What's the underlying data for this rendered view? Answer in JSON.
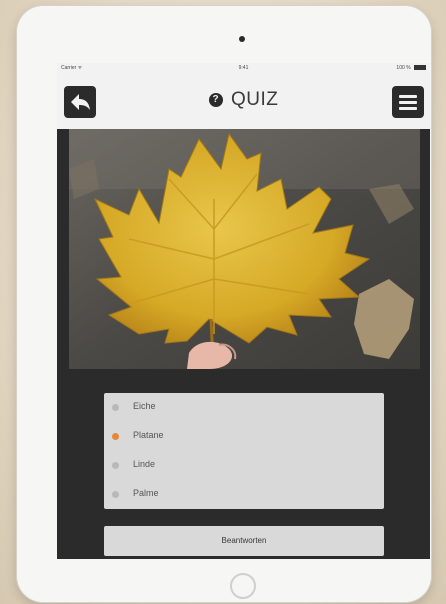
{
  "statusbar": {
    "left": "Carrier ᯤ",
    "center": "9:41",
    "right": "100 %"
  },
  "navbar": {
    "title": "QUIZ",
    "back_icon": "back-arrow-icon",
    "help_icon": "question-circle-icon",
    "menu_icon": "hamburger-menu-icon",
    "help_glyph": "?"
  },
  "photo": {
    "icon": "maple-leaf-photo"
  },
  "options": [
    {
      "label": "Eiche",
      "selected": false
    },
    {
      "label": "Platane",
      "selected": true
    },
    {
      "label": "Linde",
      "selected": false
    },
    {
      "label": "Palme",
      "selected": false
    }
  ],
  "answer_button": {
    "label": "Beantworten"
  },
  "colors": {
    "accent": "#e8853a",
    "dark": "#2b2b2b",
    "panel": "#d9d9d9"
  }
}
